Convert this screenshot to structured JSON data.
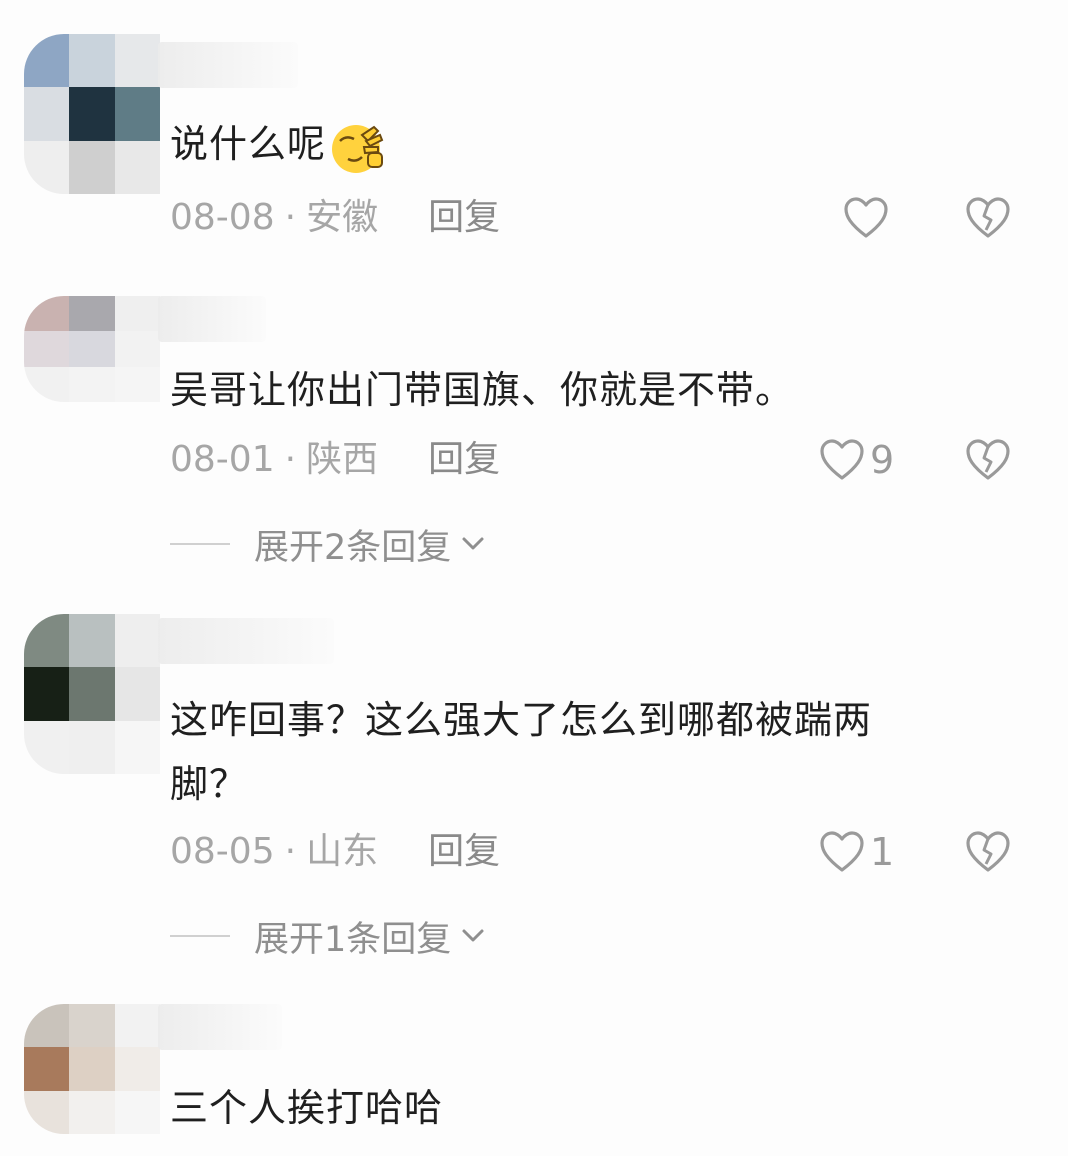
{
  "comments": [
    {
      "text": "说什么呢",
      "emoji": "facepalm-emoji",
      "date": "08-08",
      "location": "安徽",
      "reply_label": "回复",
      "like_count": "",
      "expand_label": ""
    },
    {
      "text": "吴哥让你出门带国旗、你就是不带。",
      "date": "08-01",
      "location": "陕西",
      "reply_label": "回复",
      "like_count": "9",
      "expand_label": "展开2条回复"
    },
    {
      "text_line1": "这咋回事？这么强大了怎么到哪都被踹两",
      "text_line2": "脚？",
      "date": "08-05",
      "location": "山东",
      "reply_label": "回复",
      "like_count": "1",
      "expand_label": "展开1条回复"
    },
    {
      "text": "三个人挨打哈哈"
    }
  ],
  "separator": "·",
  "icons": {
    "like": "heart-outline-icon",
    "dislike": "broken-heart-icon",
    "expand": "chevron-down-icon"
  },
  "colors": {
    "text": "#1f1f1f",
    "meta": "#a6a6a6",
    "icon": "#9a9a9a"
  }
}
